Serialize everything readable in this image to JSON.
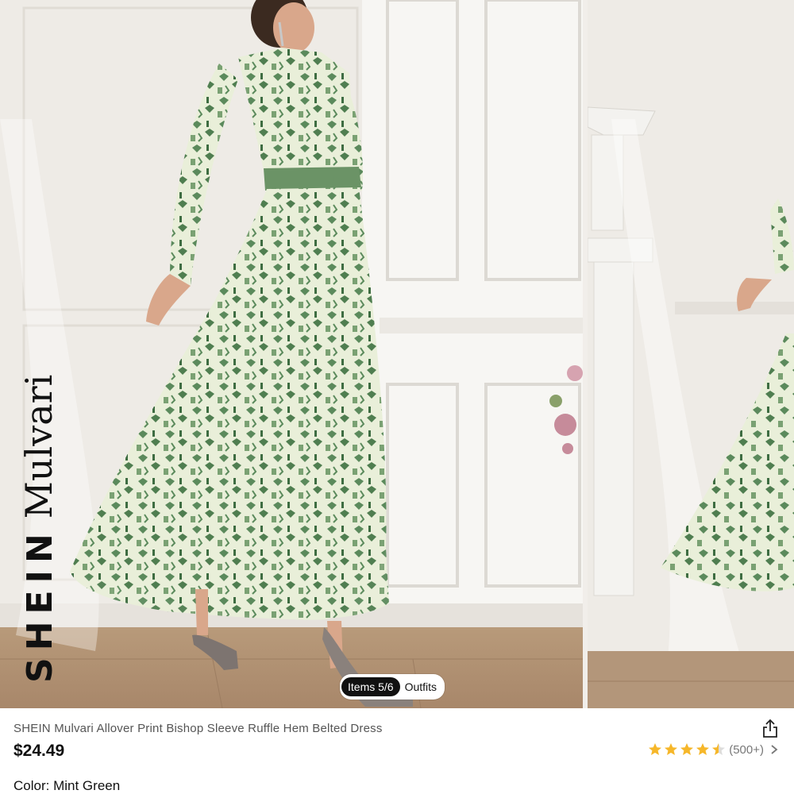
{
  "gallery": {
    "brand_logo": {
      "wordmark": "SHEIN",
      "sub": "Mulvari"
    },
    "items_pill": {
      "active_label": "Items 5/6",
      "inactive_label": "Outfits"
    }
  },
  "product": {
    "title": "SHEIN Mulvari Allover Print Bishop Sleeve Ruffle Hem Belted Dress",
    "price": "$24.49",
    "rating": {
      "value": 4.5,
      "max": 5,
      "count_text": "(500+)"
    },
    "color_label": "Color:",
    "color_value": "Mint Green"
  },
  "icons": {
    "share": "share-icon",
    "star": "star-icon",
    "chevron": "chevron-right-icon"
  },
  "colors": {
    "star": "#f6b72a",
    "dress_dark": "#5b8a5c",
    "dress_light": "#e9efd9",
    "pill_active_bg": "#111111"
  }
}
